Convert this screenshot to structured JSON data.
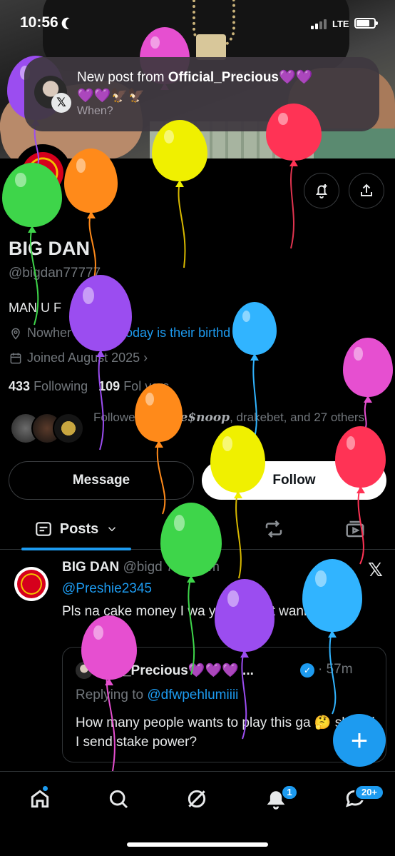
{
  "status_bar": {
    "time": "10:56",
    "network": "LTE"
  },
  "notification": {
    "prefix": "New post from ",
    "author": "Official_Precious💜💜",
    "line2": "💜💜🦅🦅",
    "body": "When?",
    "badge": "𝕏"
  },
  "profile": {
    "name": "BIG DAN",
    "handle": "@bigdan77777",
    "bio": "MAN U F",
    "location": "Nowher",
    "website": "oday is their birthd",
    "joined": "Joined August 2025 ›",
    "following_count": "433",
    "following_label": "Following",
    "followers_count": "109",
    "followers_label": "Fol       vers",
    "followed_by_prefix": "Followe      r,",
    "followed_by_name": "Uncle$noop",
    "followed_by_suffix": ", drakebet, and 27 others"
  },
  "actions": {
    "message": "Message",
    "follow": "Follow"
  },
  "tabs": {
    "posts": "Posts"
  },
  "post": {
    "name": "BIG DAN",
    "meta": " @bigd      77 · 17m",
    "mention": "@Preshie2345",
    "text": "Pls na cake money I wa          y birt real      it wanna bet",
    "x_label": "𝕏"
  },
  "quote": {
    "name": "     icial_Precious💜💜💜 ...",
    "time": "· 57m",
    "reply_prefix": "Replying to ",
    "reply_handle": "@dfwpehlumiiii",
    "text": "How many people wants to play this ga      🤔 should I send stake power?"
  },
  "fab": "+",
  "nav": {
    "notifications_badge": "1",
    "messages_badge": "20+"
  },
  "balloon_colors": [
    "#e64fd0",
    "#f0f000",
    "#ff3355",
    "#9b4df0",
    "#31b4ff",
    "#ff8a1a",
    "#3ed54a"
  ]
}
